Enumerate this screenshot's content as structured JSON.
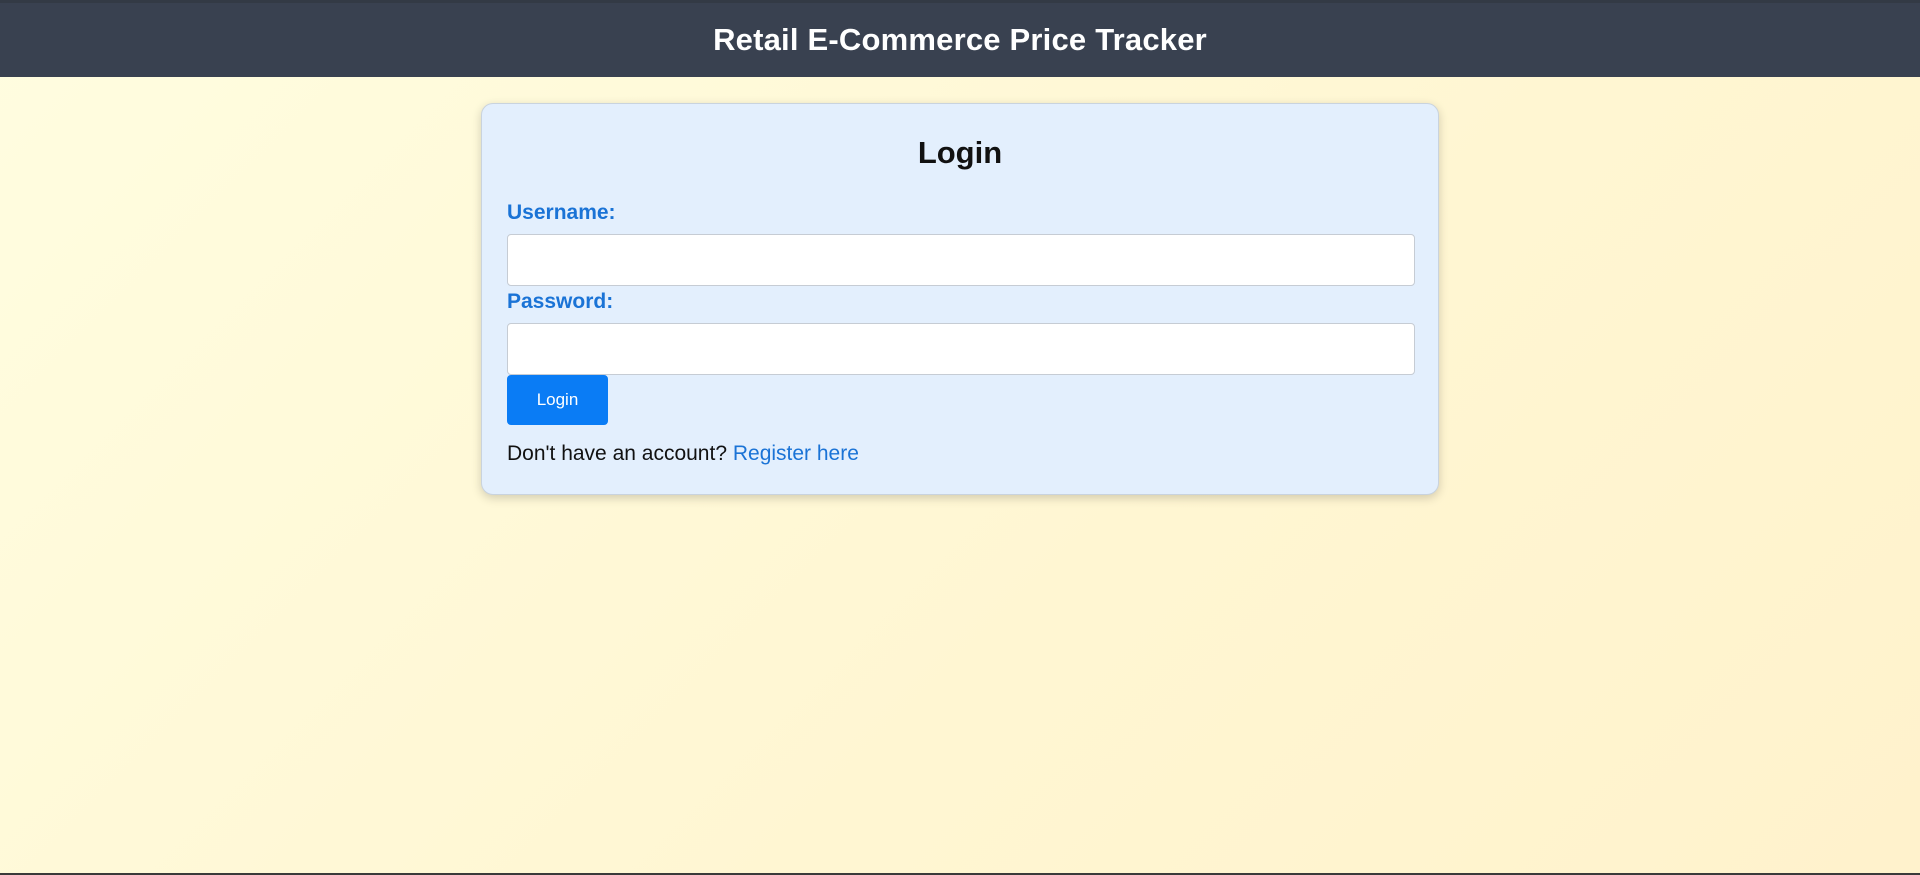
{
  "header": {
    "title": "Retail E-Commerce Price Tracker"
  },
  "login_form": {
    "heading": "Login",
    "username_label": "Username:",
    "username_value": "",
    "password_label": "Password:",
    "password_value": "",
    "submit_label": "Login",
    "register_prompt": "Don't have an account?",
    "register_link": "Register here"
  },
  "colors": {
    "header_bg": "#394150",
    "card_bg": "#e3effd",
    "accent": "#0a7cf5",
    "label_blue": "#1a73d6",
    "page_bg": "#fff8d8"
  }
}
